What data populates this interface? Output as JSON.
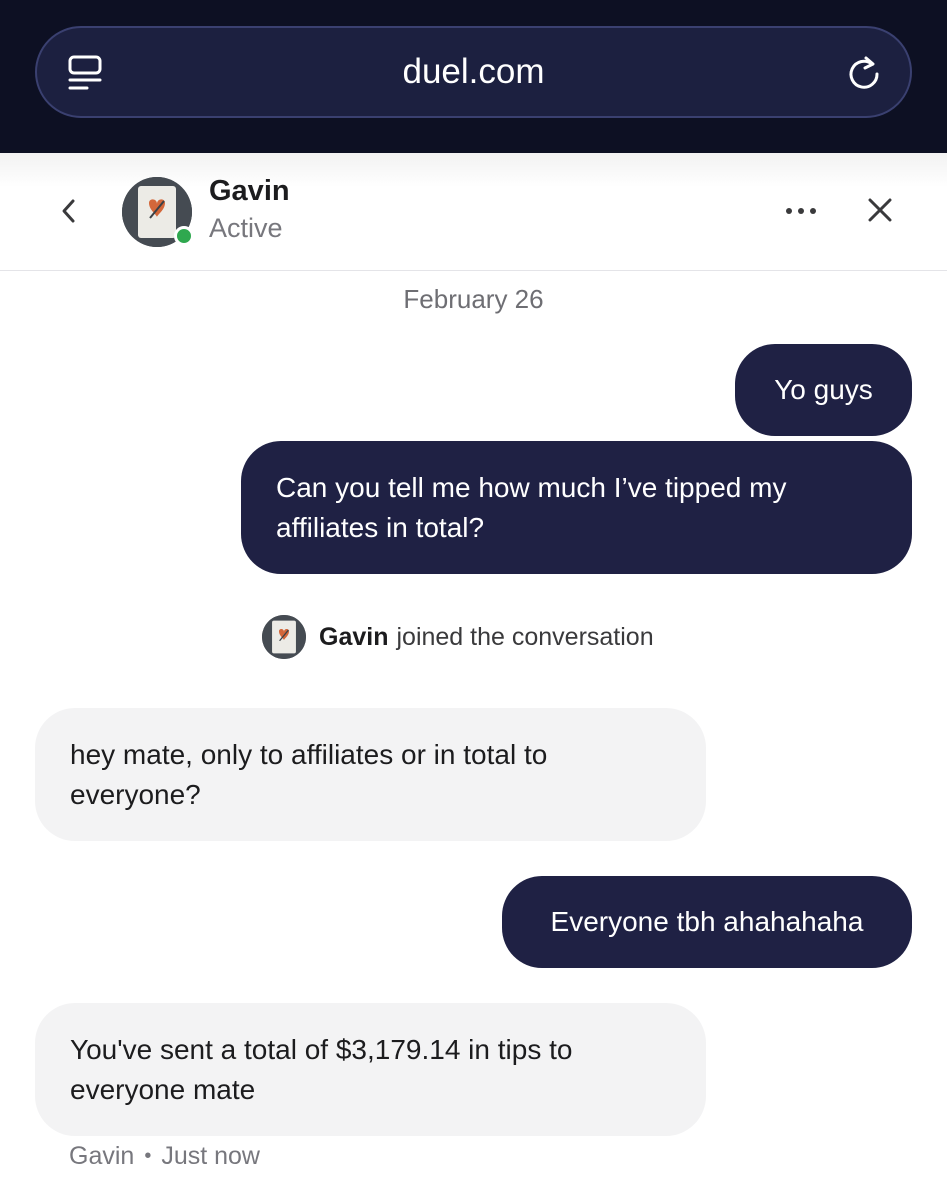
{
  "browser": {
    "url": "duel.com",
    "tabs_icon": "tabs-icon",
    "reload_icon": "reload-icon"
  },
  "header": {
    "contact_name": "Gavin",
    "status": "Active",
    "status_color": "#2fa84f",
    "back_icon": "chevron-left-icon",
    "more_icon": "more-horizontal-icon",
    "close_icon": "close-icon"
  },
  "conversation": {
    "date": "February 26",
    "messages": [
      {
        "direction": "outgoing",
        "text": "Yo guys"
      },
      {
        "direction": "outgoing",
        "text": "Can you tell me how much I’ve tipped my affiliates in total?"
      },
      {
        "direction": "incoming",
        "text": "hey mate, only to affiliates or in total to everyone?"
      },
      {
        "direction": "outgoing",
        "text": "Everyone tbh ahahahaha"
      },
      {
        "direction": "incoming",
        "text": "You've sent a total of $3,179.14 in tips to everyone mate"
      }
    ],
    "join_notice": {
      "name": "Gavin",
      "text": "joined the conversation"
    },
    "last_meta": {
      "sender": "Gavin",
      "separator": "•",
      "time": "Just now"
    }
  },
  "colors": {
    "browser_bg": "#0d1023",
    "outgoing_bubble": "#1f2144",
    "incoming_bubble": "#f3f3f4"
  }
}
